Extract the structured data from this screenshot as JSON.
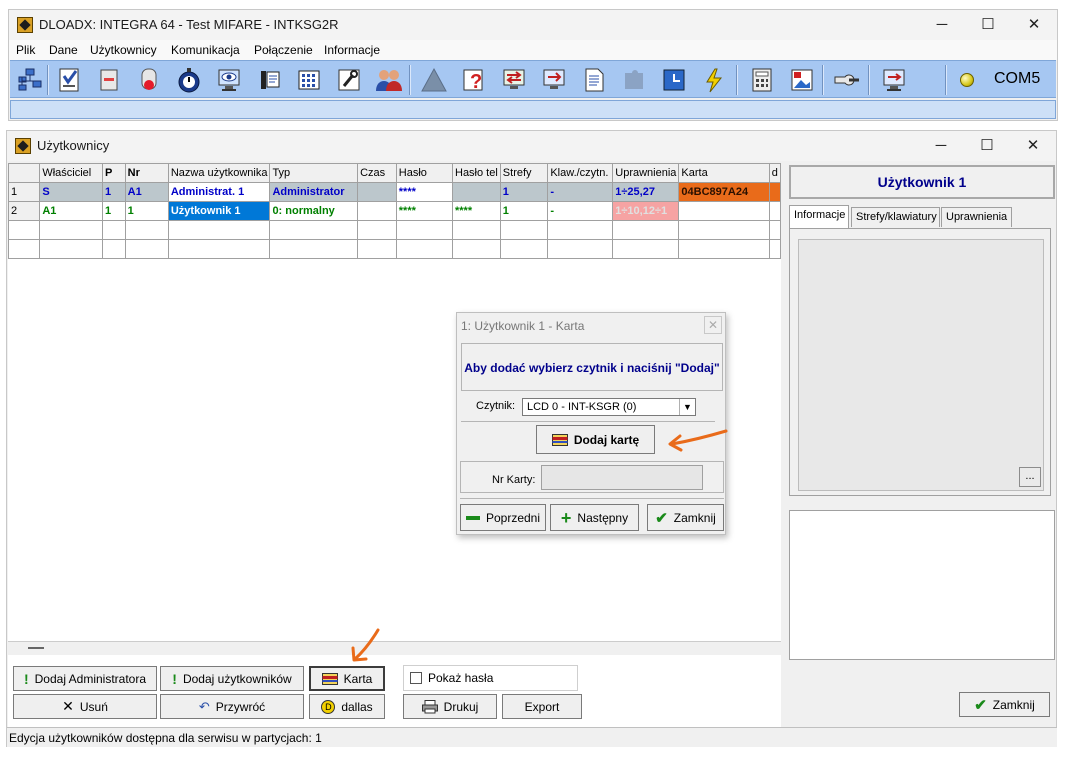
{
  "main_window": {
    "title": "DLOADX: INTEGRA 64 - Test MIFARE - INTKSG2R",
    "controls": {
      "minimize": "─",
      "maximize": "☐",
      "close": "✕"
    },
    "menu": [
      "Plik",
      "Dane",
      "Użytkownicy",
      "Komunikacja",
      "Połączenie",
      "Informacje"
    ],
    "toolbar_icons": [
      "structure-icon",
      "checklist-icon",
      "module-icon",
      "siren-icon",
      "timer-icon",
      "monitor-eye-icon",
      "phone-icon",
      "keypad-icon",
      "tools-icon",
      "users-icon",
      "triangle-icon",
      "question-icon",
      "transfer-icon",
      "screen-arrow-icon",
      "document-icon",
      "puzzle-icon",
      "clock-icon",
      "lightning-icon",
      "calculator-icon",
      "picture-icon",
      "key-icon",
      "pc-connect-icon"
    ],
    "com_port": "COM5"
  },
  "users_window": {
    "title": "Użytkownicy",
    "table": {
      "headers": [
        "",
        "Właściciel",
        "P",
        "Nr",
        "Nazwa użytkownika",
        "Typ",
        "Czas",
        "Hasło",
        "Hasło tel",
        "Strefy",
        "Klaw./czytn.",
        "Uprawnienia",
        "Karta",
        "d"
      ],
      "rows": [
        [
          "1",
          "S",
          "1",
          "A1",
          "Administrat. 1",
          "Administrator",
          "",
          "****",
          "",
          "1",
          "-",
          "1÷25,27",
          "04BC897A24",
          ""
        ],
        [
          "2",
          "A1",
          "1",
          "1",
          "Użytkownik   1",
          "0: normalny",
          "",
          "****",
          "****",
          "1",
          "-",
          "1÷10,12÷1",
          "",
          ""
        ]
      ]
    },
    "right_panel": {
      "header": "Użytkownik   1",
      "tabs": [
        "Informacje",
        "Strefy/klawiatury",
        "Uprawnienia"
      ],
      "dots": "..."
    },
    "buttons": {
      "add_admin": "Dodaj Administratora",
      "add_users": "Dodaj użytkowników",
      "card": "Karta",
      "show_passwords": "Pokaż hasła",
      "delete": "Usuń",
      "restore": "Przywróć",
      "dallas": "dallas",
      "print": "Drukuj",
      "export": "Export",
      "close": "Zamknij"
    }
  },
  "dialog": {
    "title": "1: Użytkownik   1 - Karta",
    "close": "✕",
    "message": "Aby dodać wybierz czytnik i naciśnij \"Dodaj\"",
    "reader_label": "Czytnik:",
    "reader_value": "LCD 0 - INT-KSGR    (0)",
    "add_card": "Dodaj kartę",
    "card_nr_label": "Nr Karty:",
    "card_nr_value": "",
    "prev": "Poprzedni",
    "next": "Następny",
    "close_btn": "Zamknij"
  },
  "status_bar": "Edycja użytkowników dostępna dla serwisu w partycjach: 1",
  "colors": {
    "accent_orange": "#e96b1a",
    "owner_blue": "#0000c8",
    "owner_green": "#008000",
    "toolbar": "#a6c7f2"
  }
}
